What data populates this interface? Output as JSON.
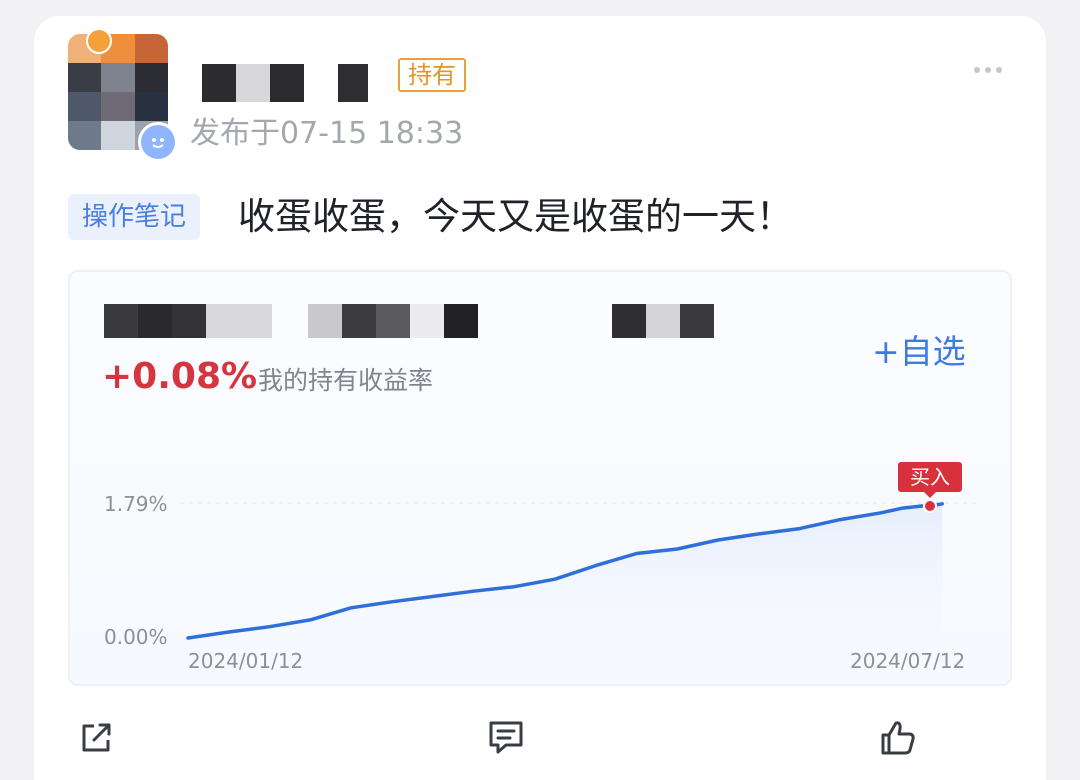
{
  "post": {
    "hold_badge": "持有",
    "publish_time": "发布于07-15 18:33",
    "tag": "操作笔记",
    "text": "收蛋收蛋，今天又是收蛋的一天！"
  },
  "fund": {
    "return_value": "+0.08%",
    "return_label": "我的持有收益率",
    "add_watchlist": "+自选"
  },
  "chart_data": {
    "type": "line",
    "x_labels": [
      "2024/01/12",
      "2024/07/12"
    ],
    "y_labels": [
      "1.79%",
      "0.00%"
    ],
    "ylim": [
      0,
      1.79
    ],
    "series": [
      {
        "x": [
          "2024/01/12",
          "2024/01/22",
          "2024/02/01",
          "2024/02/11",
          "2024/02/21",
          "2024/03/02",
          "2024/03/12",
          "2024/03/22",
          "2024/04/01",
          "2024/04/11",
          "2024/04/21",
          "2024/05/01",
          "2024/05/11",
          "2024/05/21",
          "2024/05/31",
          "2024/06/10",
          "2024/06/20",
          "2024/06/30",
          "2024/07/05",
          "2024/07/10",
          "2024/07/12",
          "2024/07/15"
        ],
        "values": [
          0.0,
          0.08,
          0.15,
          0.24,
          0.4,
          0.48,
          0.55,
          0.62,
          0.68,
          0.78,
          0.96,
          1.12,
          1.18,
          1.3,
          1.38,
          1.45,
          1.57,
          1.66,
          1.72,
          1.75,
          1.75,
          1.78
        ]
      }
    ],
    "annotation": {
      "label": "买入",
      "x": "2024/07/12"
    },
    "colors": {
      "line": "#2f6fdb",
      "marker": "#d8303c",
      "area": "#e6eefc"
    }
  },
  "actions": {
    "share_icon": "share-icon",
    "comment_icon": "comment-icon",
    "like_icon": "thumbs-up-icon"
  }
}
